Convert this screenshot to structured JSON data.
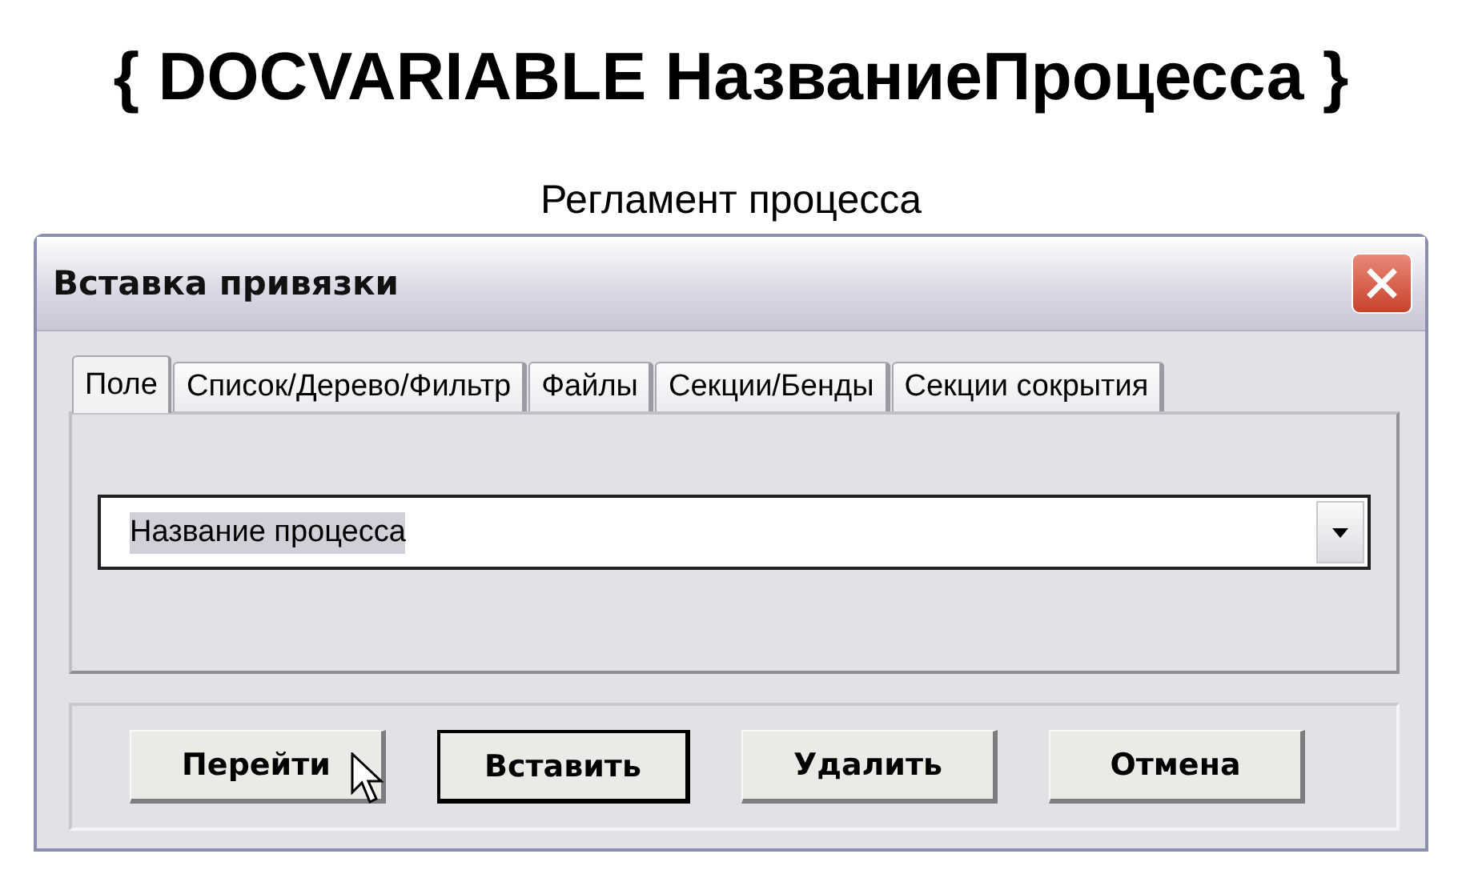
{
  "heading": "{ DOCVARIABLE НазваниеПроцесса }",
  "subtitle": "Регламент процесса",
  "dialog": {
    "title": "Вставка привязки",
    "tabs": [
      {
        "label": "Поле",
        "selected": true
      },
      {
        "label": "Список/Дерево/Фильтр",
        "selected": false
      },
      {
        "label": "Файлы",
        "selected": false
      },
      {
        "label": "Секции/Бенды",
        "selected": false
      },
      {
        "label": "Секции сокрытия",
        "selected": false
      }
    ],
    "combo": {
      "value": "Название процесса",
      "text_selected": true
    },
    "buttons": [
      {
        "label": "Перейти",
        "default": false,
        "hovered": true
      },
      {
        "label": "Вставить",
        "default": true,
        "hovered": false
      },
      {
        "label": "Удалить",
        "default": false,
        "hovered": false
      },
      {
        "label": "Отмена",
        "default": false,
        "hovered": false
      }
    ]
  }
}
